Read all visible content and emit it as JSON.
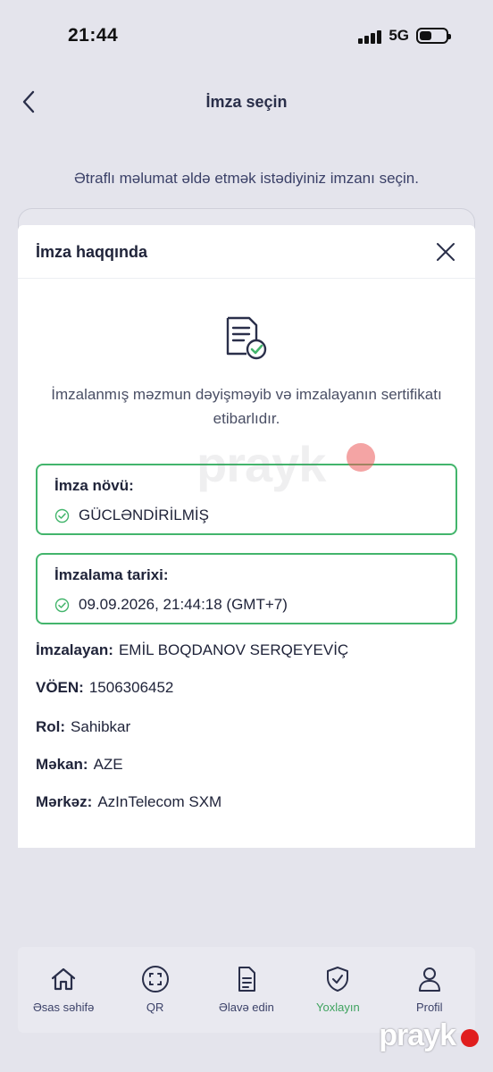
{
  "status_bar": {
    "time": "21:44",
    "network": "5G",
    "battery_level": 0.45
  },
  "header": {
    "title": "İmza seçin"
  },
  "instruction": "Ətraflı məlumat əldə etmək istədiyiniz imzanı seçin.",
  "modal": {
    "title": "İmza haqqında",
    "message": "İmzalanmış məzmun dəyişməyib və imzalayanın sertifikatı etibarlıdır.",
    "signature_type": {
      "label": "İmza növü:",
      "value": "GÜCLƏNDİRİLMİŞ"
    },
    "signing_date": {
      "label": "İmzalama tarixi:",
      "value": "09.09.2026, 21:44:18 (GMT+7)"
    },
    "details": [
      {
        "label": "İmzalayan:",
        "value": "EMİL BOQDANOV SERQEYEVİÇ"
      },
      {
        "label": "VÖEN:",
        "value": "1506306452"
      },
      {
        "label": "Rol:",
        "value": "Sahibkar"
      },
      {
        "label": "Məkan:",
        "value": "AZE"
      },
      {
        "label": "Mərkəz:",
        "value": "AzInTelecom SXM"
      }
    ]
  },
  "watermark": "prayk",
  "tab_bar": {
    "items": [
      {
        "label": "Əsas səhifə",
        "icon": "home-icon"
      },
      {
        "label": "QR",
        "icon": "qr-scan-icon"
      },
      {
        "label": "Əlavə edin",
        "icon": "document-icon"
      },
      {
        "label": "Yoxlayın",
        "icon": "shield-check-icon"
      },
      {
        "label": "Profil",
        "icon": "user-icon"
      }
    ],
    "active_index": 3
  },
  "corner_brand": "prayk",
  "colors": {
    "accent_green": "#43b56c",
    "active_tab": "#3fa35f",
    "text_primary": "#20243a",
    "background": "#e4e4ec"
  }
}
